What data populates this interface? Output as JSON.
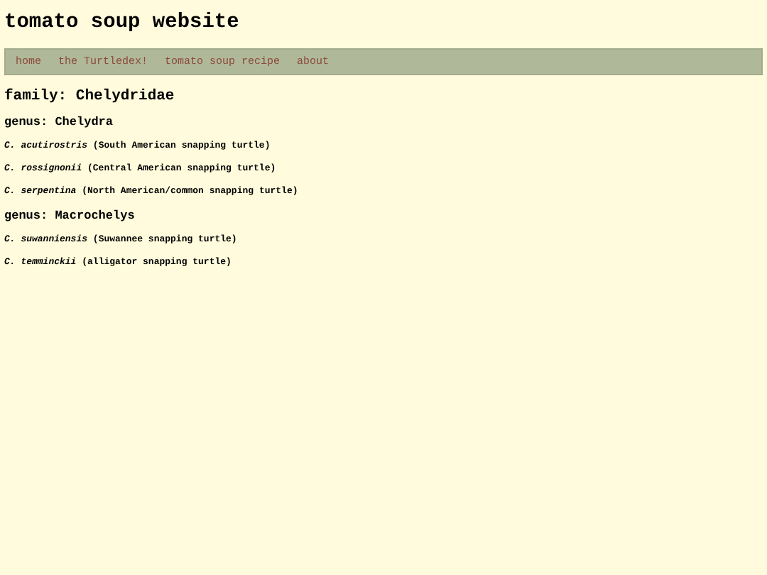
{
  "site_title": "tomato soup website",
  "nav": [
    {
      "label": "home"
    },
    {
      "label": "the Turtledex!"
    },
    {
      "label": "tomato soup recipe"
    },
    {
      "label": "about"
    }
  ],
  "family": "family: Chelydridae",
  "genera": [
    {
      "name": "genus: Chelydra",
      "species": [
        "*C. acutirostris* (South American snapping turtle)",
        "*C. rossignonii* (Central American snapping turtle)",
        "*C. serpentina* (North American/common snapping turtle)"
      ]
    },
    {
      "name": "genus: Macrochelys",
      "species": [
        "*C. suwanniensis* (Suwannee snapping turtle)",
        "*C. temminckii* (alligator snapping turtle)"
      ]
    }
  ]
}
